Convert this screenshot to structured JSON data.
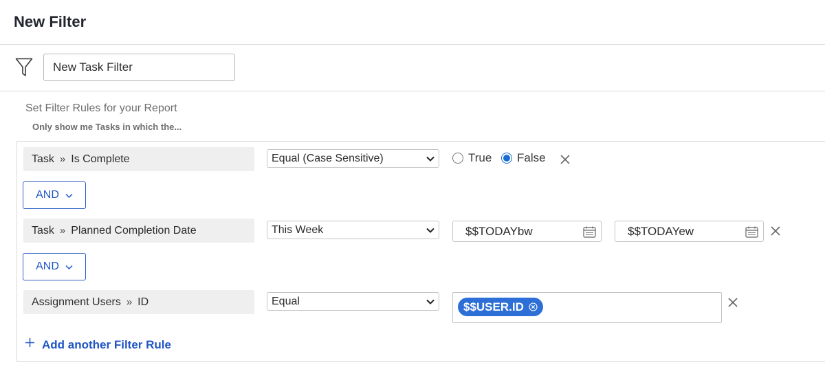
{
  "header": {
    "title": "New Filter"
  },
  "filter_name": {
    "value": "New Task Filter",
    "icon": "funnel-icon"
  },
  "rules_intro": {
    "heading": "Set Filter Rules for your Report",
    "subheading": "Only show me Tasks in which the..."
  },
  "rules": [
    {
      "field_parent": "Task",
      "field_name": "Is Complete",
      "operator": "Equal (Case Sensitive)",
      "options": [
        {
          "label": "True",
          "selected": false
        },
        {
          "label": "False",
          "selected": true
        }
      ]
    },
    {
      "field_parent": "Task",
      "field_name": "Planned Completion Date",
      "operator": "This Week",
      "start_value": "$$TODAYbw",
      "end_value": "$$TODAYew"
    },
    {
      "field_parent": "Assignment Users",
      "field_name": "ID",
      "operator": "Equal",
      "tokens": [
        "$$USER.ID"
      ]
    }
  ],
  "connectors": [
    "AND",
    "AND"
  ],
  "add_rule_label": "Add another Filter Rule",
  "colors": {
    "accent": "#1f55c4",
    "token_bg": "#2d6fd6",
    "chip_bg": "#efefef",
    "border": "#d8d8d8"
  }
}
